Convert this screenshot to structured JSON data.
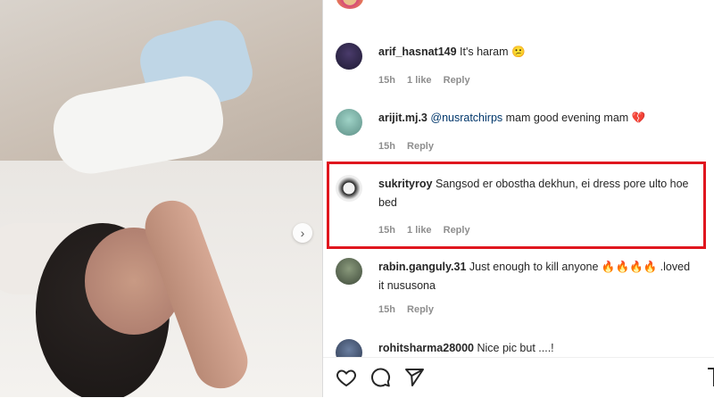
{
  "post": {
    "image_alt": "photo",
    "next_arrow": "›"
  },
  "comments": [
    {
      "username": "arif_hasnat149",
      "text": "It's haram",
      "emoji": "😕",
      "time": "15h",
      "likes": "1 like",
      "reply": "Reply"
    },
    {
      "username": "arijit.mj.3",
      "mention": "@nusratchirps",
      "text": "mam good evening mam",
      "emoji": "💔",
      "time": "15h",
      "reply": "Reply"
    },
    {
      "username": "sukrityroy",
      "text": "Sangsod er obostha dekhun, ei dress pore ulto hoe bed",
      "time": "15h",
      "likes": "1 like",
      "reply": "Reply"
    },
    {
      "username": "rabin.ganguly.31",
      "text": "Just enough to kill anyone",
      "emoji": "🔥🔥🔥🔥",
      "text_after": ".loved it nususona",
      "time": "15h",
      "reply": "Reply"
    },
    {
      "username": "rohitsharma28000",
      "text": "Nice pic but ....!"
    }
  ],
  "icons": {
    "like": "heart-icon",
    "comment": "comment-icon",
    "share": "share-icon",
    "save": "bookmark-icon"
  },
  "colors": {
    "highlight_border": "#e0161e",
    "mention": "#00376b",
    "meta": "#8e8e8e"
  }
}
